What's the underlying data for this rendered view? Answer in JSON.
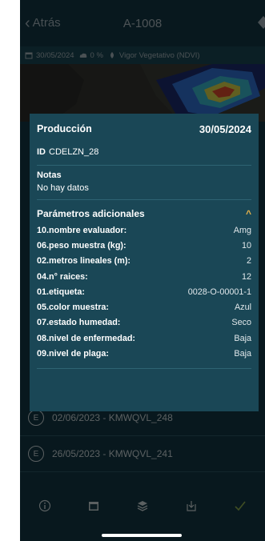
{
  "header": {
    "back_label": "Atrás",
    "title": "A-1008"
  },
  "infobar": {
    "date": "30/05/2024",
    "cloud": "0 %",
    "layer": "Vigor Vegetativo (NDVI)"
  },
  "popup": {
    "section_title": "Producción",
    "date": "30/05/2024",
    "id_label": "ID",
    "id_value": "CDELZN_28",
    "notes_title": "Notas",
    "notes_value": "No hay datos",
    "params_title": "Parámetros adicionales",
    "params": [
      {
        "key": "10.nombre evaluador:",
        "value": "Amg"
      },
      {
        "key": "06.peso muestra (kg):",
        "value": "10"
      },
      {
        "key": "02.metros lineales (m):",
        "value": "2"
      },
      {
        "key": "04.n° raices:",
        "value": "12"
      },
      {
        "key": "01.etiqueta:",
        "value": "0028-O-00001-1"
      },
      {
        "key": "05.color muestra:",
        "value": "Azul"
      },
      {
        "key": "07.estado humedad:",
        "value": "Seco"
      },
      {
        "key": "08.nivel de enfermedad:",
        "value": "Baja"
      },
      {
        "key": "09.nivel de plaga:",
        "value": "Baja"
      }
    ]
  },
  "list": [
    {
      "badge": "E",
      "label": "02/06/2023 - KMWQVL_248"
    },
    {
      "badge": "E",
      "label": "26/05/2023 - KMWQVL_241"
    }
  ],
  "colors": {
    "background": "#123743",
    "popup": "#1a4756",
    "accent": "#e8b34a"
  },
  "bottom_icons": [
    "info-icon",
    "calendar-icon",
    "layers-icon",
    "download-icon",
    "check-icon"
  ]
}
